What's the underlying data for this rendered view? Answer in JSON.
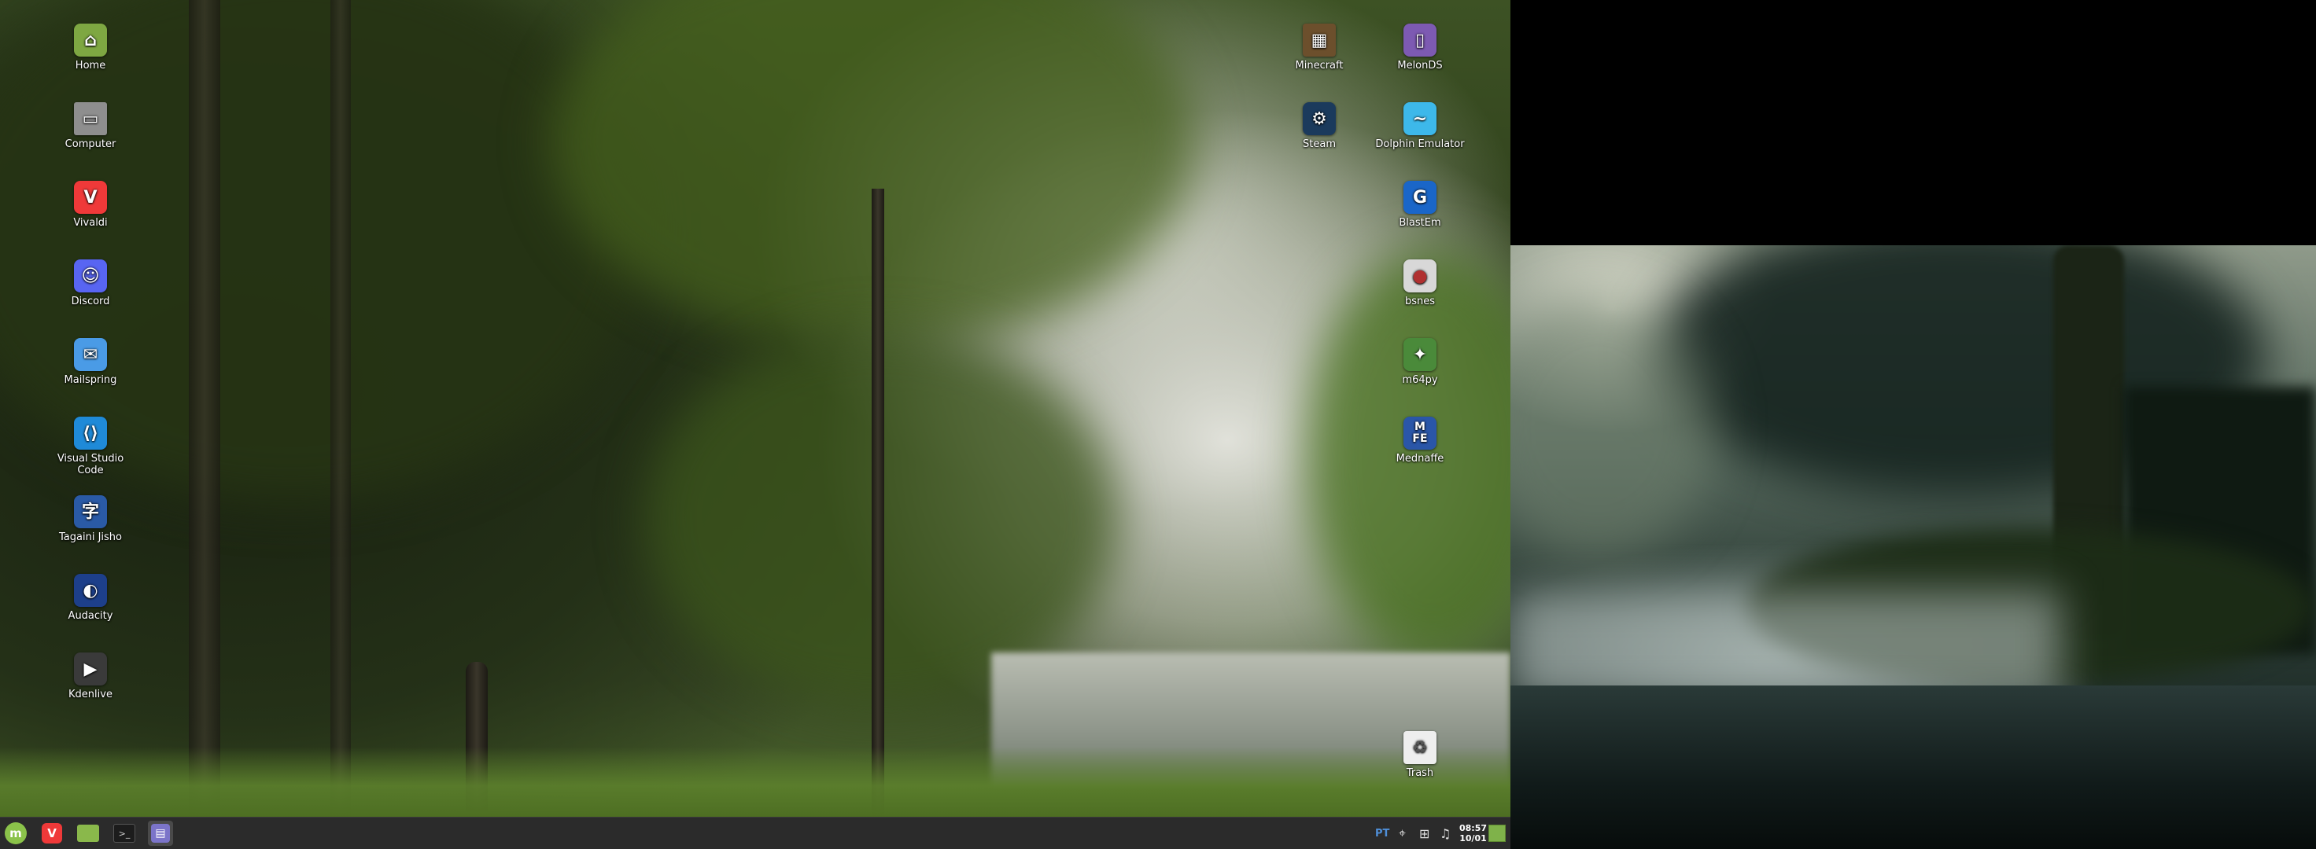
{
  "desktop_left": {
    "icons_left": [
      {
        "label": "Home",
        "icon": "folder-home-icon",
        "color": "#7ea742"
      },
      {
        "label": "Computer",
        "icon": "computer-icon",
        "color": "#8e8e8e"
      },
      {
        "label": "Vivaldi",
        "icon": "vivaldi-icon",
        "color": "#ef3939"
      },
      {
        "label": "Discord",
        "icon": "discord-icon",
        "color": "#5865f2"
      },
      {
        "label": "Mailspring",
        "icon": "mailspring-icon",
        "color": "#4a9be6"
      },
      {
        "label": "Visual Studio Code",
        "icon": "vscode-icon",
        "color": "#1f8ad8"
      },
      {
        "label": "Tagaini Jisho",
        "icon": "tagaini-jisho-icon",
        "color": "#2a5aa6"
      },
      {
        "label": "Audacity",
        "icon": "audacity-icon",
        "color": "#1d3f8a"
      },
      {
        "label": "Kdenlive",
        "icon": "kdenlive-icon",
        "color": "#3a3a3a"
      }
    ],
    "icons_right_col1": [
      {
        "label": "Minecraft",
        "icon": "minecraft-icon",
        "color": "#6c4f2c"
      },
      {
        "label": "Steam",
        "icon": "steam-icon",
        "color": "#1b3a5c"
      }
    ],
    "icons_right_col2": [
      {
        "label": "MelonDS",
        "icon": "melonds-icon",
        "color": "#7d5ab2"
      },
      {
        "label": "Dolphin Emulator",
        "icon": "dolphin-icon",
        "color": "#3db8ea"
      },
      {
        "label": "BlastEm",
        "icon": "blastem-icon",
        "color": "#1a66c8"
      },
      {
        "label": "bsnes",
        "icon": "bsnes-icon",
        "color": "#d8d8d8"
      },
      {
        "label": "m64py",
        "icon": "m64py-icon",
        "color": "#4a8a3a"
      },
      {
        "label": "Mednaffe",
        "icon": "mednaffe-icon",
        "color": "#2a56a8"
      }
    ],
    "trash": {
      "label": "Trash",
      "icon": "trash-icon"
    }
  },
  "taskbar": {
    "menu_icon": "linux-mint-menu-icon",
    "launchers": [
      {
        "name": "vivaldi",
        "icon": "vivaldi-icon"
      },
      {
        "name": "files",
        "icon": "folder-icon"
      },
      {
        "name": "terminal",
        "icon": "terminal-icon"
      },
      {
        "name": "text-editor",
        "icon": "text-editor-icon"
      }
    ],
    "tray": {
      "keyboard_layout": "PT",
      "time": "08:57",
      "date": "10/01"
    }
  }
}
